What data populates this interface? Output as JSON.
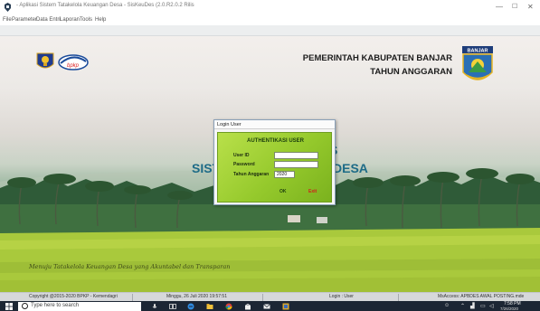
{
  "window": {
    "title": "- Aplikasi Sistem Tatakelola Keuangan Desa - SisKeuDes (2.0.R2.0.2 Rilis",
    "controls": {
      "minimize": "—",
      "maximize": "☐",
      "close": "✕"
    }
  },
  "menu": {
    "items": [
      "File",
      "Parameter",
      "Data Entri",
      "Laporan",
      "Tools",
      "Help"
    ]
  },
  "header": {
    "gov_title": "PEMERINTAH KABUPATEN BANJAR",
    "year_title": "TAHUN ANGGARAN",
    "emblem_label": "BANJAR",
    "bpkp_logo_text": "bpkp"
  },
  "background": {
    "app_name_left": "SIST",
    "app_name_right": "DESA",
    "app_logo_fragment": "S",
    "motto": "Menuju Tatakelola Keuangan Desa yang Akuntabel dan Transparan"
  },
  "login": {
    "window_title": "Login User",
    "heading": "AUTHENTIKASI USER",
    "user_label": "User ID",
    "user_value": "",
    "password_label": "Password",
    "password_value": "",
    "year_label": "Tahun Anggaran",
    "year_value": "2020",
    "ok_label": "OK",
    "exit_label": "Exit"
  },
  "statusbar": {
    "copyright": "Copyright @2015-2020 BPKP - Kemendagri",
    "datetime": "Minggu, 26 Juli 2020  19:57:51",
    "login_status": "Login : User",
    "db_info": "MsAccess: APBDES AWAL POSTING.mde"
  },
  "taskbar": {
    "search_placeholder": "Type here to search",
    "clock_time": "7:58 PM",
    "clock_date": "7/26/2020"
  },
  "colors": {
    "taskbar": "#1c2634",
    "dialog_panel": "#95c92c",
    "title_text": "#1d6b87"
  }
}
